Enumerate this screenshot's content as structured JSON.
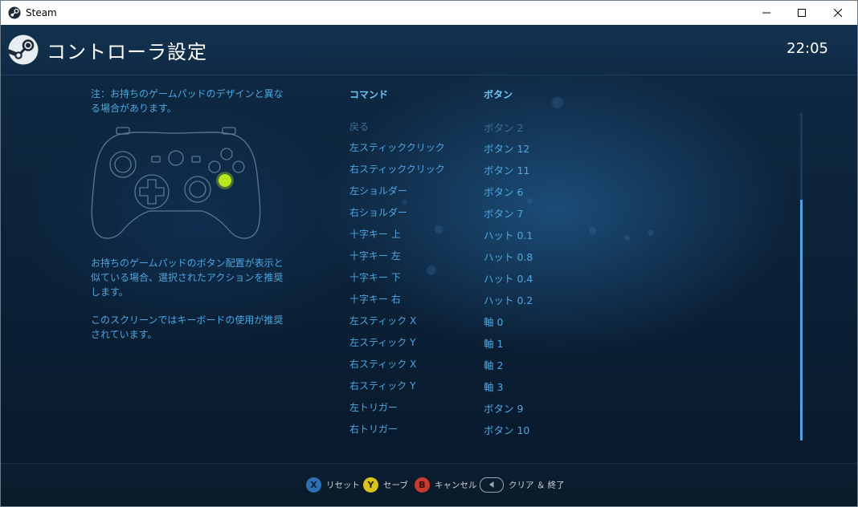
{
  "window": {
    "title": "Steam"
  },
  "header": {
    "title": "コントローラ設定",
    "clock": "22:05"
  },
  "left_panel": {
    "note": "注：お持ちのゲームパッドのデザインと異なる場合があります。",
    "description": "お持ちのゲームパッドのボタン配置が表示と似ている場合、選択されたアクションを推奨します。",
    "keyboard_note": "このスクリーンではキーボードの使用が推奨されています。"
  },
  "table": {
    "headers": {
      "command": "コマンド",
      "button": "ボタン"
    },
    "rows": [
      {
        "command": "戻る",
        "button": "ボタン 2"
      },
      {
        "command": "左スティッククリック",
        "button": "ボタン 12"
      },
      {
        "command": "右スティッククリック",
        "button": "ボタン 11"
      },
      {
        "command": "左ショルダー",
        "button": "ボタン 6"
      },
      {
        "command": "右ショルダー",
        "button": "ボタン 7"
      },
      {
        "command": "十字キー 上",
        "button": "ハット 0.1"
      },
      {
        "command": "十字キー 左",
        "button": "ハット 0.8"
      },
      {
        "command": "十字キー 下",
        "button": "ハット 0.4"
      },
      {
        "command": "十字キー 右",
        "button": "ハット 0.2"
      },
      {
        "command": "左スティック X",
        "button": "軸 0"
      },
      {
        "command": "左スティック Y",
        "button": "軸 1"
      },
      {
        "command": "右スティック X",
        "button": "軸 2"
      },
      {
        "command": "右スティック Y",
        "button": "軸 3"
      },
      {
        "command": "左トリガー",
        "button": "ボタン 9"
      },
      {
        "command": "右トリガー",
        "button": "ボタン 10"
      }
    ]
  },
  "footer": {
    "hints": [
      {
        "glyph": "X",
        "label": "リセット",
        "color": "#2d6fb5"
      },
      {
        "glyph": "Y",
        "label": "セーブ",
        "color": "#d8c21b"
      },
      {
        "glyph": "B",
        "label": "キャンセル",
        "color": "#c63a2f"
      },
      {
        "glyph": "back-arrow-icon",
        "label": "クリア ＆ 終了"
      }
    ]
  },
  "colors": {
    "accent": "#4da6e0",
    "highlight_button": "#b6e61e",
    "scrollbar": "#4fa3e3"
  }
}
